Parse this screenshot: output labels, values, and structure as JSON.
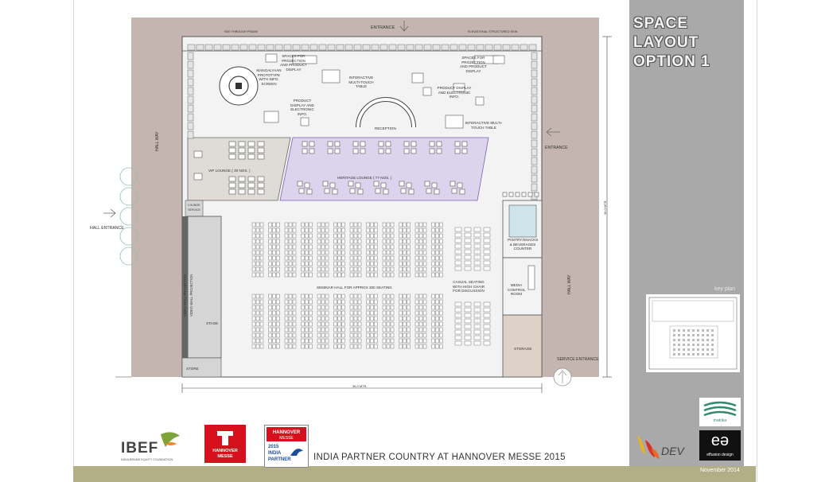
{
  "sheet": {
    "title": "SPACE\nLAYOUT\nOPTION 1",
    "footer_title": "INDIA PARTNER COUNTRY AT HANNOVER MESSE 2015",
    "date": "November 2014",
    "key_plan_label": "key plan"
  },
  "plan_labels": {
    "entrance_top": "ENTRANCE",
    "see_through_frame": "SEE THROUGH FRAME",
    "elevational_structured_skin": "ELEVATIONAL STRUCTURED SKIN",
    "spaces_left": "SPACES FOR PROJECTION AND PRODUCT DISPLAY",
    "spaces_right": "SPACES FOR PROJECTION AND PRODUCT DISPLAY",
    "mangalyaan": "MANGALYAAN PROTOTYPE WITH INFO. SCREEN",
    "interactive_table_1": "INTERACTIVE MULTI-TOUCH TABLE",
    "interactive_table_2": "INTERACTIVE MULTI-TOUCH TABLE",
    "product_display_1": "PRODUCT DISPLAY AND ELECTRONIC INFO.",
    "product_display_2": "PRODUCT DISPLAY AND ELECTRONIC INFO.",
    "reception": "RECEPTION",
    "entrance_right": "ENTRANCE",
    "hall_way_left": "HALL WAY",
    "hall_way_right": "HALL WAY",
    "vip_lounge": "VIP LOUNGE ( 20 NOS. )",
    "heritage_lounge": "HERITAGE LOUNGE ( 77 NOS. )",
    "lounge_service": "LOUNGE SERVICE",
    "hall_entrance": "HALL ENTRANCE",
    "pantry": "PANTRY/SNACKS & BEVERAGES COUNTER",
    "seminar_hall": "SEMINAR HALL FOR APPROX 300 SEATING",
    "casual_seating": "CASUAL SEATING WITH HIGH CHAIR FOR DISCUSSION",
    "media_control": "MEDIA CONTROL ROOM",
    "video_wall_1": "VIDEO WALL PROJECTION",
    "video_wall_2": "VIDEO WALL PROJECTION",
    "stage": "STAGE",
    "storage": "STORAGE",
    "store": "STORE",
    "service_entrance": "SERVICE ENTRANCE",
    "dim_horizontal": "36.0 MTR.",
    "dim_vertical": "36.0 MTR."
  },
  "logos": {
    "ibef_name": "IBEF",
    "ibef_sub": "INDIA BRAND EQUITY FOUNDATION",
    "hm_line1": "HANNOVER",
    "hm_line2": "MESSE",
    "hm2_line1": "HANNOVER",
    "hm2_line2": "MESSE",
    "hm2_year": "2015",
    "hm2_line3": "INDIA",
    "hm2_line4": "PARTNER",
    "dev": "DEV",
    "matrika": "matrika",
    "ed_name": "effusion design",
    "ed_mark": "eə"
  },
  "colors": {
    "hallway": "#c5b5b0",
    "floor": "#f1f1f1",
    "sidebar": "#a9a9a9",
    "heritage": "#dcd3ec",
    "vip": "#dfdcd8",
    "stage": "#d5d5d5",
    "storage": "#ded2c8",
    "footer_band": "#b2ae86"
  }
}
